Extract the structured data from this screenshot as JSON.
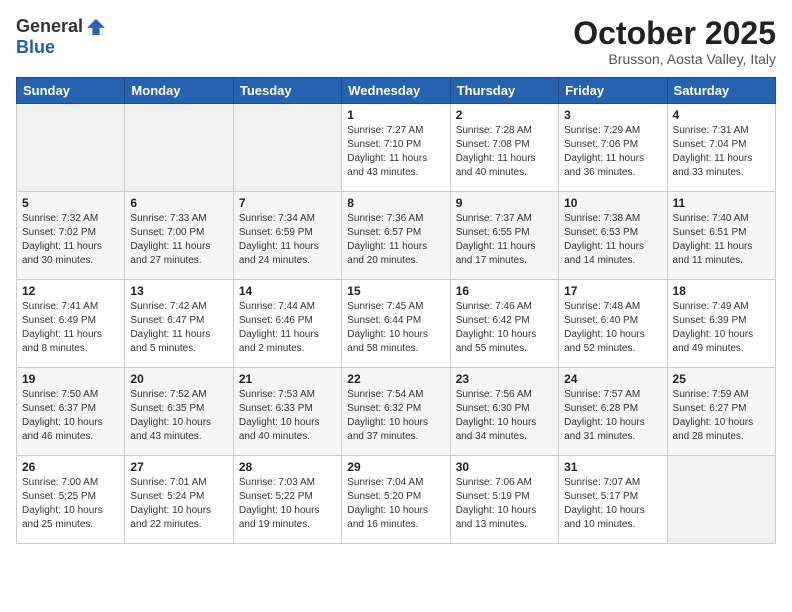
{
  "header": {
    "logo_general": "General",
    "logo_blue": "Blue",
    "month_title": "October 2025",
    "location": "Brusson, Aosta Valley, Italy"
  },
  "days_of_week": [
    "Sunday",
    "Monday",
    "Tuesday",
    "Wednesday",
    "Thursday",
    "Friday",
    "Saturday"
  ],
  "weeks": [
    [
      {
        "num": "",
        "sunrise": "",
        "sunset": "",
        "daylight": ""
      },
      {
        "num": "",
        "sunrise": "",
        "sunset": "",
        "daylight": ""
      },
      {
        "num": "",
        "sunrise": "",
        "sunset": "",
        "daylight": ""
      },
      {
        "num": "1",
        "sunrise": "Sunrise: 7:27 AM",
        "sunset": "Sunset: 7:10 PM",
        "daylight": "Daylight: 11 hours and 43 minutes."
      },
      {
        "num": "2",
        "sunrise": "Sunrise: 7:28 AM",
        "sunset": "Sunset: 7:08 PM",
        "daylight": "Daylight: 11 hours and 40 minutes."
      },
      {
        "num": "3",
        "sunrise": "Sunrise: 7:29 AM",
        "sunset": "Sunset: 7:06 PM",
        "daylight": "Daylight: 11 hours and 36 minutes."
      },
      {
        "num": "4",
        "sunrise": "Sunrise: 7:31 AM",
        "sunset": "Sunset: 7:04 PM",
        "daylight": "Daylight: 11 hours and 33 minutes."
      }
    ],
    [
      {
        "num": "5",
        "sunrise": "Sunrise: 7:32 AM",
        "sunset": "Sunset: 7:02 PM",
        "daylight": "Daylight: 11 hours and 30 minutes."
      },
      {
        "num": "6",
        "sunrise": "Sunrise: 7:33 AM",
        "sunset": "Sunset: 7:00 PM",
        "daylight": "Daylight: 11 hours and 27 minutes."
      },
      {
        "num": "7",
        "sunrise": "Sunrise: 7:34 AM",
        "sunset": "Sunset: 6:59 PM",
        "daylight": "Daylight: 11 hours and 24 minutes."
      },
      {
        "num": "8",
        "sunrise": "Sunrise: 7:36 AM",
        "sunset": "Sunset: 6:57 PM",
        "daylight": "Daylight: 11 hours and 20 minutes."
      },
      {
        "num": "9",
        "sunrise": "Sunrise: 7:37 AM",
        "sunset": "Sunset: 6:55 PM",
        "daylight": "Daylight: 11 hours and 17 minutes."
      },
      {
        "num": "10",
        "sunrise": "Sunrise: 7:38 AM",
        "sunset": "Sunset: 6:53 PM",
        "daylight": "Daylight: 11 hours and 14 minutes."
      },
      {
        "num": "11",
        "sunrise": "Sunrise: 7:40 AM",
        "sunset": "Sunset: 6:51 PM",
        "daylight": "Daylight: 11 hours and 11 minutes."
      }
    ],
    [
      {
        "num": "12",
        "sunrise": "Sunrise: 7:41 AM",
        "sunset": "Sunset: 6:49 PM",
        "daylight": "Daylight: 11 hours and 8 minutes."
      },
      {
        "num": "13",
        "sunrise": "Sunrise: 7:42 AM",
        "sunset": "Sunset: 6:47 PM",
        "daylight": "Daylight: 11 hours and 5 minutes."
      },
      {
        "num": "14",
        "sunrise": "Sunrise: 7:44 AM",
        "sunset": "Sunset: 6:46 PM",
        "daylight": "Daylight: 11 hours and 2 minutes."
      },
      {
        "num": "15",
        "sunrise": "Sunrise: 7:45 AM",
        "sunset": "Sunset: 6:44 PM",
        "daylight": "Daylight: 10 hours and 58 minutes."
      },
      {
        "num": "16",
        "sunrise": "Sunrise: 7:46 AM",
        "sunset": "Sunset: 6:42 PM",
        "daylight": "Daylight: 10 hours and 55 minutes."
      },
      {
        "num": "17",
        "sunrise": "Sunrise: 7:48 AM",
        "sunset": "Sunset: 6:40 PM",
        "daylight": "Daylight: 10 hours and 52 minutes."
      },
      {
        "num": "18",
        "sunrise": "Sunrise: 7:49 AM",
        "sunset": "Sunset: 6:39 PM",
        "daylight": "Daylight: 10 hours and 49 minutes."
      }
    ],
    [
      {
        "num": "19",
        "sunrise": "Sunrise: 7:50 AM",
        "sunset": "Sunset: 6:37 PM",
        "daylight": "Daylight: 10 hours and 46 minutes."
      },
      {
        "num": "20",
        "sunrise": "Sunrise: 7:52 AM",
        "sunset": "Sunset: 6:35 PM",
        "daylight": "Daylight: 10 hours and 43 minutes."
      },
      {
        "num": "21",
        "sunrise": "Sunrise: 7:53 AM",
        "sunset": "Sunset: 6:33 PM",
        "daylight": "Daylight: 10 hours and 40 minutes."
      },
      {
        "num": "22",
        "sunrise": "Sunrise: 7:54 AM",
        "sunset": "Sunset: 6:32 PM",
        "daylight": "Daylight: 10 hours and 37 minutes."
      },
      {
        "num": "23",
        "sunrise": "Sunrise: 7:56 AM",
        "sunset": "Sunset: 6:30 PM",
        "daylight": "Daylight: 10 hours and 34 minutes."
      },
      {
        "num": "24",
        "sunrise": "Sunrise: 7:57 AM",
        "sunset": "Sunset: 6:28 PM",
        "daylight": "Daylight: 10 hours and 31 minutes."
      },
      {
        "num": "25",
        "sunrise": "Sunrise: 7:59 AM",
        "sunset": "Sunset: 6:27 PM",
        "daylight": "Daylight: 10 hours and 28 minutes."
      }
    ],
    [
      {
        "num": "26",
        "sunrise": "Sunrise: 7:00 AM",
        "sunset": "Sunset: 5:25 PM",
        "daylight": "Daylight: 10 hours and 25 minutes."
      },
      {
        "num": "27",
        "sunrise": "Sunrise: 7:01 AM",
        "sunset": "Sunset: 5:24 PM",
        "daylight": "Daylight: 10 hours and 22 minutes."
      },
      {
        "num": "28",
        "sunrise": "Sunrise: 7:03 AM",
        "sunset": "Sunset: 5:22 PM",
        "daylight": "Daylight: 10 hours and 19 minutes."
      },
      {
        "num": "29",
        "sunrise": "Sunrise: 7:04 AM",
        "sunset": "Sunset: 5:20 PM",
        "daylight": "Daylight: 10 hours and 16 minutes."
      },
      {
        "num": "30",
        "sunrise": "Sunrise: 7:06 AM",
        "sunset": "Sunset: 5:19 PM",
        "daylight": "Daylight: 10 hours and 13 minutes."
      },
      {
        "num": "31",
        "sunrise": "Sunrise: 7:07 AM",
        "sunset": "Sunset: 5:17 PM",
        "daylight": "Daylight: 10 hours and 10 minutes."
      },
      {
        "num": "",
        "sunrise": "",
        "sunset": "",
        "daylight": ""
      }
    ]
  ]
}
